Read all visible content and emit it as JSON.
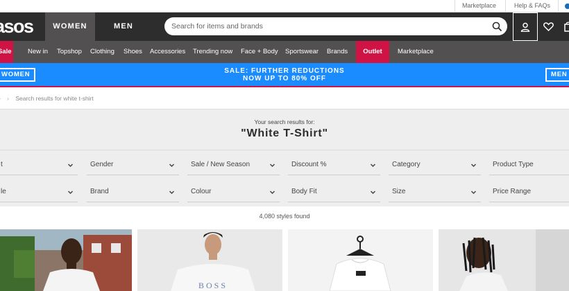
{
  "topbar": {
    "marketplace": "Marketplace",
    "help": "Help & FAQs"
  },
  "header": {
    "logo": "asos",
    "tab_women": "WOMEN",
    "tab_men": "MEN",
    "search_placeholder": "Search for items and brands"
  },
  "nav": {
    "items": [
      "Sale",
      "New in",
      "Topshop",
      "Clothing",
      "Shoes",
      "Accessories",
      "Trending now",
      "Face + Body",
      "Sportswear",
      "Brands",
      "Outlet",
      "Marketplace"
    ]
  },
  "promo": {
    "left_button": "WOMEN",
    "right_button": "MEN",
    "line1": "SALE: FURTHER REDUCTIONS",
    "line2": "NOW UP TO 80% OFF"
  },
  "breadcrumb": {
    "home": "e",
    "current": "Search results for white t-shirt"
  },
  "results": {
    "label": "Your search results for:",
    "title": "\"White T-Shirt\"",
    "count": "4,080 styles found"
  },
  "filters": {
    "row1": [
      "t",
      "Gender",
      "Sale / New Season",
      "Discount %",
      "Category",
      "Product Type"
    ],
    "row2": [
      "le",
      "Brand",
      "Colour",
      "Body Fit",
      "Size",
      "Price Range"
    ]
  },
  "colors": {
    "accent": "#d01345",
    "promo": "#1a8cff",
    "header": "#2d2d2d",
    "nav": "#525050"
  }
}
